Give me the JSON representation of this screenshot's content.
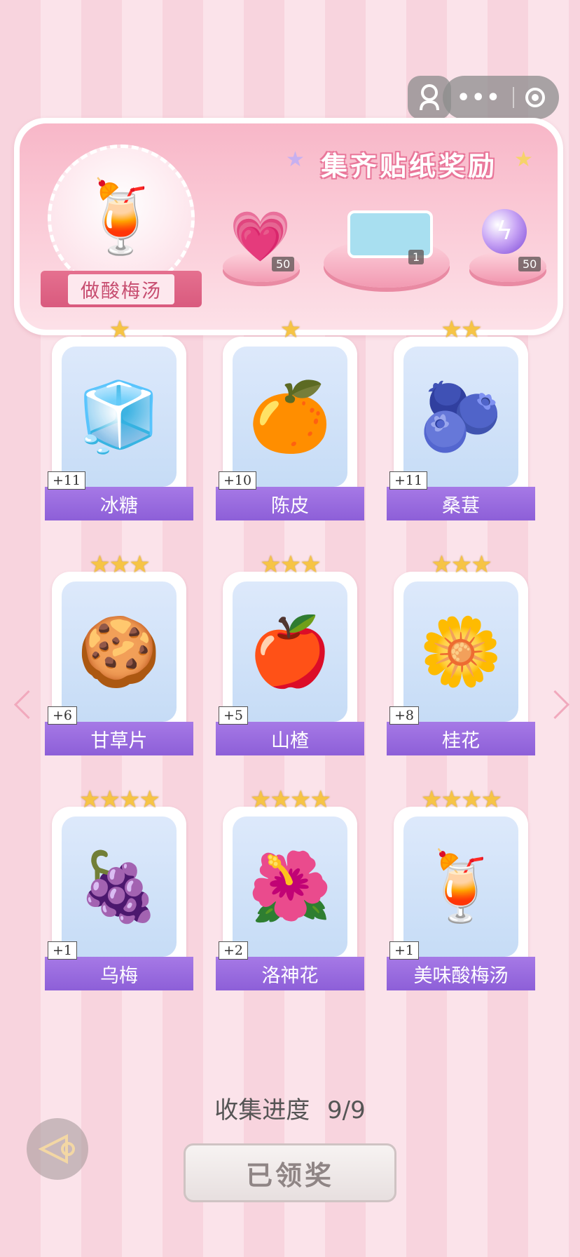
{
  "banner": {
    "title": "集齐贴纸奖励",
    "task_label": "做酸梅汤",
    "rewards": [
      {
        "icon": "heart-gem-icon",
        "count": "50"
      },
      {
        "icon": "sticker-card-icon",
        "count": "1"
      },
      {
        "icon": "energy-orb-icon",
        "count": "50"
      }
    ]
  },
  "items": [
    {
      "name": "冰糖",
      "plus": "+11",
      "stars": 1,
      "icon": "🧊"
    },
    {
      "name": "陈皮",
      "plus": "+10",
      "stars": 1,
      "icon": "🍊"
    },
    {
      "name": "桑葚",
      "plus": "+11",
      "stars": 2,
      "icon": "🫐"
    },
    {
      "name": "甘草片",
      "plus": "+6",
      "stars": 3,
      "icon": "🍪"
    },
    {
      "name": "山楂",
      "plus": "+5",
      "stars": 3,
      "icon": "🍎"
    },
    {
      "name": "桂花",
      "plus": "+8",
      "stars": 3,
      "icon": "🌼"
    },
    {
      "name": "乌梅",
      "plus": "+1",
      "stars": 4,
      "icon": "🍇"
    },
    {
      "name": "洛神花",
      "plus": "+2",
      "stars": 4,
      "icon": "🌺"
    },
    {
      "name": "美味酸梅汤",
      "plus": "+1",
      "stars": 4,
      "icon": "🍹"
    }
  ],
  "progress": {
    "label": "收集进度",
    "value": "9/9"
  },
  "claim_button": "已领奖",
  "colors": {
    "accent": "#9a6ae0",
    "banner": "#f8b7c8",
    "star": "#f6c445"
  }
}
